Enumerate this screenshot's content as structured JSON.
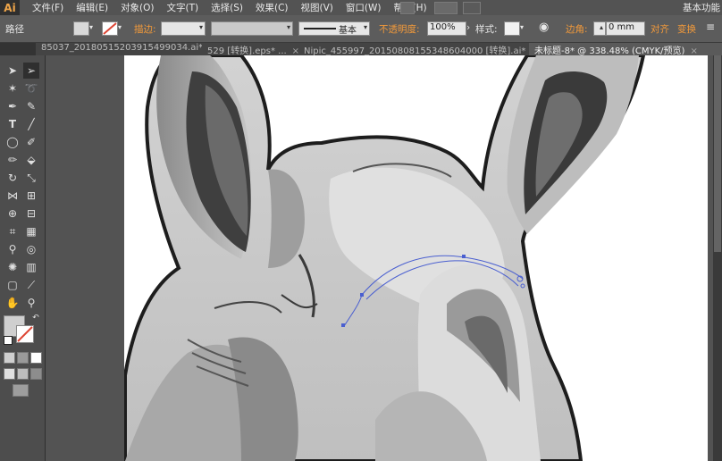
{
  "app": {
    "logo": "Ai",
    "workspace": "基本功能"
  },
  "menu": [
    "文件(F)",
    "编辑(E)",
    "对象(O)",
    "文字(T)",
    "选择(S)",
    "效果(C)",
    "视图(V)",
    "窗口(W)",
    "帮助(H)"
  ],
  "control": {
    "object_type": "路径",
    "stroke_label": "描边:",
    "brush_label": "基本",
    "opacity_label": "不透明度:",
    "opacity_value": "100%",
    "style_label": "样式:",
    "corner_label": "边角:",
    "corner_value": "0 mm",
    "align_label": "对齐",
    "transform_label": "变换"
  },
  "tabs": [
    {
      "label": "85037_20180515203915499034.ai*",
      "active": false
    },
    {
      "label": "529 [转换].eps* ...",
      "active": false
    },
    {
      "label": "Nipic_455997_20150808155348604000 [转换].ai*",
      "active": false
    },
    {
      "label": "未标题-8* @ 338.48% (CMYK/预览)",
      "active": true
    }
  ],
  "colors": {
    "accent": "#f39a3a",
    "ui_dark": "#535353",
    "path_selection": "#4a5fd0"
  },
  "tool_icons": [
    "selection-tool-icon",
    "direct-selection-tool-icon",
    "magic-wand-icon",
    "lasso-icon",
    "pen-tool-icon",
    "curvature-icon",
    "type-tool-icon",
    "line-tool-icon",
    "ellipse-tool-icon",
    "paintbrush-icon",
    "pencil-icon",
    "shaper-icon",
    "rotate-icon",
    "scale-icon",
    "width-icon",
    "free-transform-icon",
    "shape-builder-icon",
    "perspective-icon",
    "mesh-icon",
    "gradient-icon",
    "eyedropper-icon",
    "blend-icon",
    "symbol-sprayer-icon",
    "column-graph-icon",
    "artboard-tool-icon",
    "slice-icon",
    "hand-icon",
    "zoom-icon"
  ]
}
